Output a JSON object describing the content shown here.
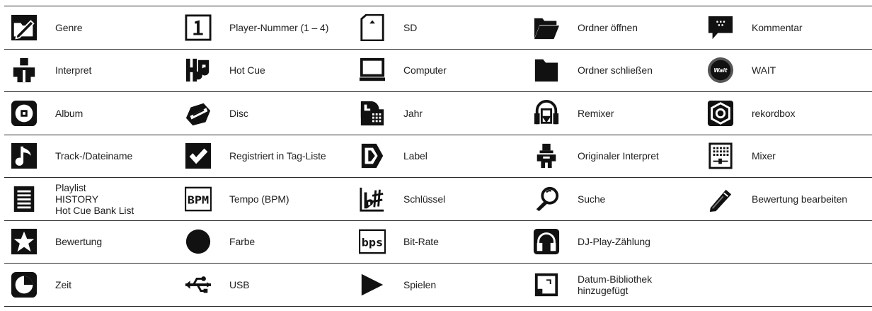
{
  "items": [
    {
      "icon": "folder-edit-icon",
      "label": "Genre"
    },
    {
      "icon": "player-number-icon",
      "label": "Player-Nummer (1 – 4)"
    },
    {
      "icon": "sd-card-icon",
      "label": "SD"
    },
    {
      "icon": "folder-open-icon",
      "label": "Ordner öffnen"
    },
    {
      "icon": "comment-icon",
      "label": "Kommentar"
    },
    {
      "icon": "artist-icon",
      "label": "Interpret"
    },
    {
      "icon": "hot-cue-icon",
      "label": "Hot Cue"
    },
    {
      "icon": "computer-icon",
      "label": "Computer"
    },
    {
      "icon": "folder-closed-icon",
      "label": "Ordner schließen"
    },
    {
      "icon": "wait-icon",
      "label": "WAIT",
      "text": "Wait"
    },
    {
      "icon": "album-icon",
      "label": "Album"
    },
    {
      "icon": "disc-icon",
      "label": "Disc"
    },
    {
      "icon": "year-calendar-icon",
      "label": "Jahr"
    },
    {
      "icon": "remixer-icon",
      "label": "Remixer"
    },
    {
      "icon": "rekordbox-icon",
      "label": "rekordbox"
    },
    {
      "icon": "music-note-icon",
      "label": "Track-/Dateiname"
    },
    {
      "icon": "checkmark-icon",
      "label": "Registriert in Tag-Liste"
    },
    {
      "icon": "label-icon",
      "label": "Label"
    },
    {
      "icon": "original-artist-icon",
      "label": "Originaler Interpret"
    },
    {
      "icon": "mixer-icon",
      "label": "Mixer"
    },
    {
      "icon": "playlist-icon",
      "label": "Playlist\nHISTORY\nHot Cue Bank List"
    },
    {
      "icon": "bpm-icon",
      "label": "Tempo (BPM)",
      "text": "BPM"
    },
    {
      "icon": "key-icon",
      "label": "Schlüssel"
    },
    {
      "icon": "search-icon",
      "label": "Suche"
    },
    {
      "icon": "edit-rating-icon",
      "label": "Bewertung bearbeiten"
    },
    {
      "icon": "star-icon",
      "label": "Bewertung"
    },
    {
      "icon": "color-icon",
      "label": "Farbe"
    },
    {
      "icon": "bit-rate-icon",
      "label": "Bit-Rate",
      "text": "bps"
    },
    {
      "icon": "headphones-icon",
      "label": "DJ-Play-Zählung"
    },
    {
      "icon": "",
      "label": ""
    },
    {
      "icon": "time-icon",
      "label": "Zeit"
    },
    {
      "icon": "usb-icon",
      "label": "USB"
    },
    {
      "icon": "play-icon",
      "label": "Spielen"
    },
    {
      "icon": "date-added-icon",
      "label": "Datum-Bibliothek\nhinzugefügt"
    },
    {
      "icon": "",
      "label": ""
    }
  ]
}
